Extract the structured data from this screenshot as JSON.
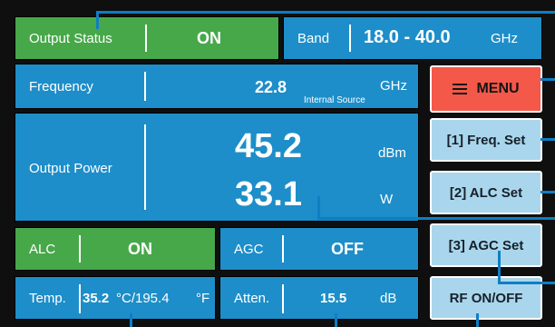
{
  "status": {
    "label": "Output Status",
    "value": "ON"
  },
  "band": {
    "label": "Band",
    "value": "18.0 - 40.0",
    "unit": "GHz"
  },
  "frequency": {
    "label": "Frequency",
    "value": "22.8",
    "source": "Internal Source",
    "unit": "GHz"
  },
  "output_power": {
    "label": "Output Power",
    "dbm_value": "45.2",
    "dbm_unit": "dBm",
    "w_value": "33.1",
    "w_unit": "W"
  },
  "alc": {
    "label": "ALC",
    "value": "ON"
  },
  "agc": {
    "label": "AGC",
    "value": "OFF"
  },
  "temperature": {
    "label": "Temp.",
    "value": "35.2",
    "reading": "°C/195.4",
    "unit": "°F"
  },
  "attenuation": {
    "label": "Atten.",
    "value": "15.5",
    "unit": "dB"
  },
  "buttons": {
    "menu": "MENU",
    "freq_set": "[1] Freq. Set",
    "alc_set": "[2] ALC Set",
    "agc_set": "[3] AGC Set",
    "rf_onoff": "RF ON/OFF"
  },
  "colors": {
    "panel_blue": "#1d8ec9",
    "status_green": "#47a84a",
    "menu_red": "#f35849",
    "button_light_blue": "#a9d6ec",
    "callout_line": "#0e7ec4"
  }
}
